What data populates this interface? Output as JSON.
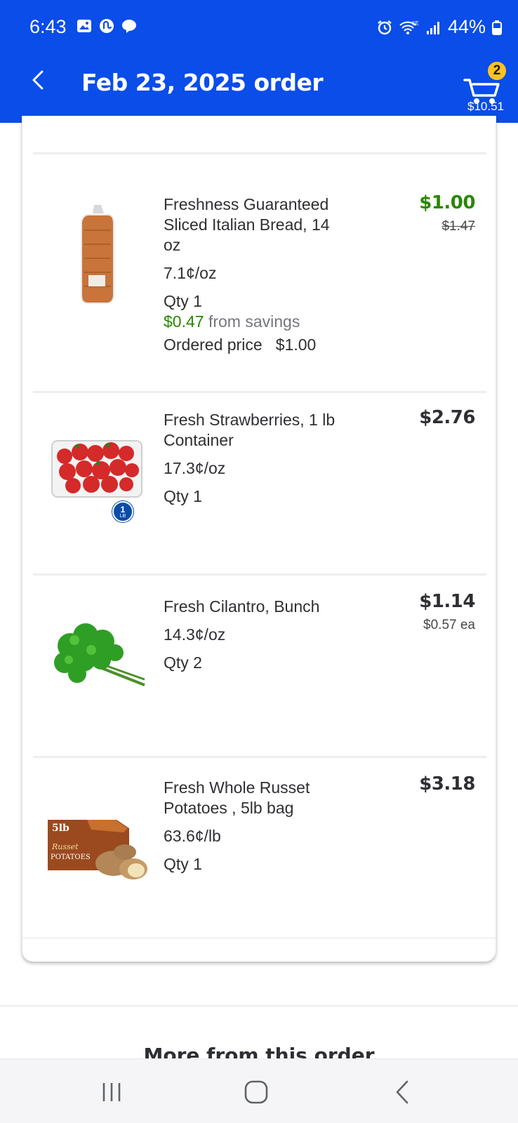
{
  "status_bar": {
    "time": "6:43",
    "battery": "44%",
    "network": "6E"
  },
  "header": {
    "title": "Feb 23, 2025 order",
    "cart_count": "2",
    "cart_total": "$10.51"
  },
  "items": [
    {
      "name_lines": [
        "Freshness Guaranteed",
        "Sliced Italian Bread, 14",
        "oz"
      ],
      "unit_price": "7.1¢/oz",
      "qty": "Qty 1",
      "savings_amount": "$0.47",
      "savings_text": "from savings",
      "ordered_label": "Ordered price",
      "ordered_value": "$1.00",
      "price": "$1.00",
      "original_price": "$1.47",
      "image": "bread-loaf-image"
    },
    {
      "name_lines": [
        "Fresh Strawberries, 1 lb",
        "Container"
      ],
      "unit_price": "17.3¢/oz",
      "qty": "Qty 1",
      "price": "$2.76",
      "badge": "1",
      "badge_sub": "LB",
      "image": "strawberries-container-image"
    },
    {
      "name_lines": [
        "Fresh Cilantro, Bunch"
      ],
      "unit_price": "14.3¢/oz",
      "qty": "Qty 2",
      "price": "$1.14",
      "each_price": "$0.57 ea",
      "image": "cilantro-bunch-image"
    },
    {
      "name_lines": [
        "Fresh Whole Russet",
        "Potatoes , 5lb bag"
      ],
      "unit_price": "63.6¢/lb",
      "qty": "Qty 1",
      "price": "$3.18",
      "image": "russet-potatoes-bag-image",
      "package_text": [
        "5lb",
        "Russet",
        "POTATOES"
      ]
    }
  ],
  "more_section": {
    "title": "More from this order"
  },
  "colors": {
    "brand_blue": "#0a4de8",
    "badge_yellow": "#ffc220",
    "sale_green": "#2a8703"
  }
}
